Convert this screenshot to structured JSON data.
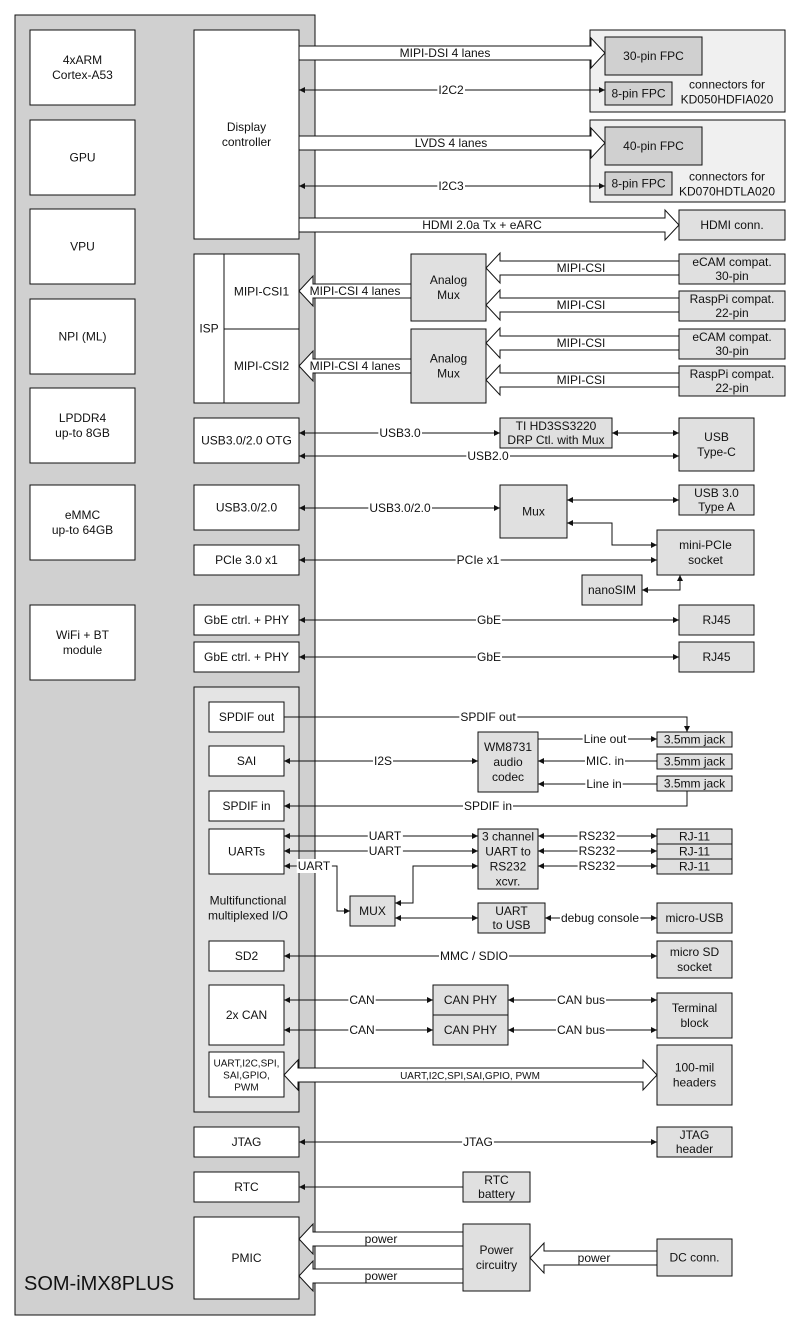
{
  "title": "SOM-iMX8PLUS",
  "colors": {
    "som": "#d0d0d0",
    "inner": "#ffffff",
    "ext": "#e0e0e0",
    "group": "#f0f0f0",
    "fpc": "#d0d0d0",
    "mfio": "#e4e4e4"
  },
  "som_blocks": {
    "cpu": [
      "4xARM",
      "Cortex-A53"
    ],
    "gpu": [
      "GPU"
    ],
    "vpu": [
      "VPU"
    ],
    "npu": [
      "NPI (ML)"
    ],
    "ram": [
      "LPDDR4",
      "up-to 8GB"
    ],
    "emmc": [
      "eMMC",
      "up-to 64GB"
    ],
    "wifi": [
      "WiFi + BT",
      "module"
    ],
    "display": [
      "Display",
      "controller"
    ],
    "isp": [
      "ISP"
    ],
    "csi1": [
      "MIPI-CSI1"
    ],
    "csi2": [
      "MIPI-CSI2"
    ],
    "usb_otg": [
      "USB3.0/2.0 OTG"
    ],
    "usb": [
      "USB3.0/2.0"
    ],
    "pcie": [
      "PCIe 3.0 x1"
    ],
    "gbe1": [
      "GbE ctrl. + PHY"
    ],
    "gbe2": [
      "GbE ctrl. + PHY"
    ],
    "spdif_out": [
      "SPDIF out"
    ],
    "sai": [
      "SAI"
    ],
    "spdif_in": [
      "SPDIF in"
    ],
    "uarts": [
      "UARTs"
    ],
    "mfio_label": [
      "Multifunctional",
      "multiplexed I/O"
    ],
    "sd2": [
      "SD2"
    ],
    "can": [
      "2x CAN"
    ],
    "gpio": [
      "UART,I2C,SPI,",
      "SAI,GPIO,",
      "PWM"
    ],
    "jtag": [
      "JTAG"
    ],
    "rtc": [
      "RTC"
    ],
    "pmic": [
      "PMIC"
    ]
  },
  "external": {
    "fpc30": [
      "30-pin FPC"
    ],
    "fpc8a": [
      "8-pin FPC"
    ],
    "group1": [
      "connectors for",
      "KD050HDFIA020"
    ],
    "fpc40": [
      "40-pin FPC"
    ],
    "fpc8b": [
      "8-pin FPC"
    ],
    "group2": [
      "connectors for",
      "KD070HDTLA020"
    ],
    "hdmi": [
      "HDMI conn."
    ],
    "mux1": [
      "Analog",
      "Mux"
    ],
    "mux2": [
      "Analog",
      "Mux"
    ],
    "ecam1": [
      "eCAM compat.",
      "30-pin"
    ],
    "rpi1": [
      "RaspPi compat.",
      "22-pin"
    ],
    "ecam2": [
      "eCAM compat.",
      "30-pin"
    ],
    "rpi2": [
      "RaspPi compat.",
      "22-pin"
    ],
    "ti": [
      "TI HD3SS3220",
      "DRP Ctl. with Mux"
    ],
    "usbc": [
      "USB",
      "Type-C"
    ],
    "usbmux": [
      "Mux"
    ],
    "usba": [
      "USB 3.0",
      "Type A"
    ],
    "minipcie": [
      "mini-PCIe",
      "socket"
    ],
    "nanosim": [
      "nanoSIM"
    ],
    "rj45a": [
      "RJ45"
    ],
    "rj45b": [
      "RJ45"
    ],
    "codec": [
      "WM8731",
      "audio",
      "codec"
    ],
    "jack1": [
      "3.5mm jack"
    ],
    "jack2": [
      "3.5mm jack"
    ],
    "jack3": [
      "3.5mm jack"
    ],
    "rs232x": [
      "3 channel",
      "UART to",
      "RS232",
      "xcvr."
    ],
    "rj11a": [
      "RJ-11"
    ],
    "rj11b": [
      "RJ-11"
    ],
    "rj11c": [
      "RJ-11"
    ],
    "muxu": [
      "MUX"
    ],
    "uartusb": [
      "UART",
      "to USB"
    ],
    "microusb": [
      "micro-USB"
    ],
    "microsd": [
      "micro SD",
      "socket"
    ],
    "canphy1": [
      "CAN PHY"
    ],
    "canphy2": [
      "CAN PHY"
    ],
    "terminal": [
      "Terminal",
      "block"
    ],
    "headers": [
      "100-mil",
      "headers"
    ],
    "jtaghdr": [
      "JTAG",
      "header"
    ],
    "rtcbat": [
      "RTC",
      "battery"
    ],
    "power": [
      "Power",
      "circuitry"
    ],
    "dc": [
      "DC conn."
    ]
  },
  "links": {
    "dsi": "MIPI-DSI 4 lanes",
    "i2c2": "I2C2",
    "lvds": "LVDS 4 lanes",
    "i2c3": "I2C3",
    "hdmi": "HDMI 2.0a Tx + eARC",
    "csi_bus1": "MIPI-CSI 4 lanes",
    "csi_bus2": "MIPI-CSI 4 lanes",
    "csi_a": "MIPI-CSI",
    "csi_b": "MIPI-CSI",
    "csi_c": "MIPI-CSI",
    "csi_d": "MIPI-CSI",
    "usb30": "USB3.0",
    "usb20": "USB2.0",
    "usb3020": "USB3.0/2.0",
    "pcie": "PCIe x1",
    "gbe1": "GbE",
    "gbe2": "GbE",
    "spdif_out": "SPDIF out",
    "i2s": "I2S",
    "line_out": "Line out",
    "mic_in": "MIC. in",
    "line_in": "Line in",
    "spdif_in": "SPDIF in",
    "uart1": "UART",
    "uart2": "UART",
    "uart3": "UART",
    "rs232a": "RS232",
    "rs232b": "RS232",
    "rs232c": "RS232",
    "debug": "debug console",
    "mmc": "MMC / SDIO",
    "can1": "CAN",
    "can2": "CAN",
    "canbus1": "CAN bus",
    "canbus2": "CAN bus",
    "gpio_bus": "UART,I2C,SPI,SAI,GPIO, PWM",
    "jtag": "JTAG",
    "power1": "power",
    "power2": "power",
    "power3": "power"
  }
}
